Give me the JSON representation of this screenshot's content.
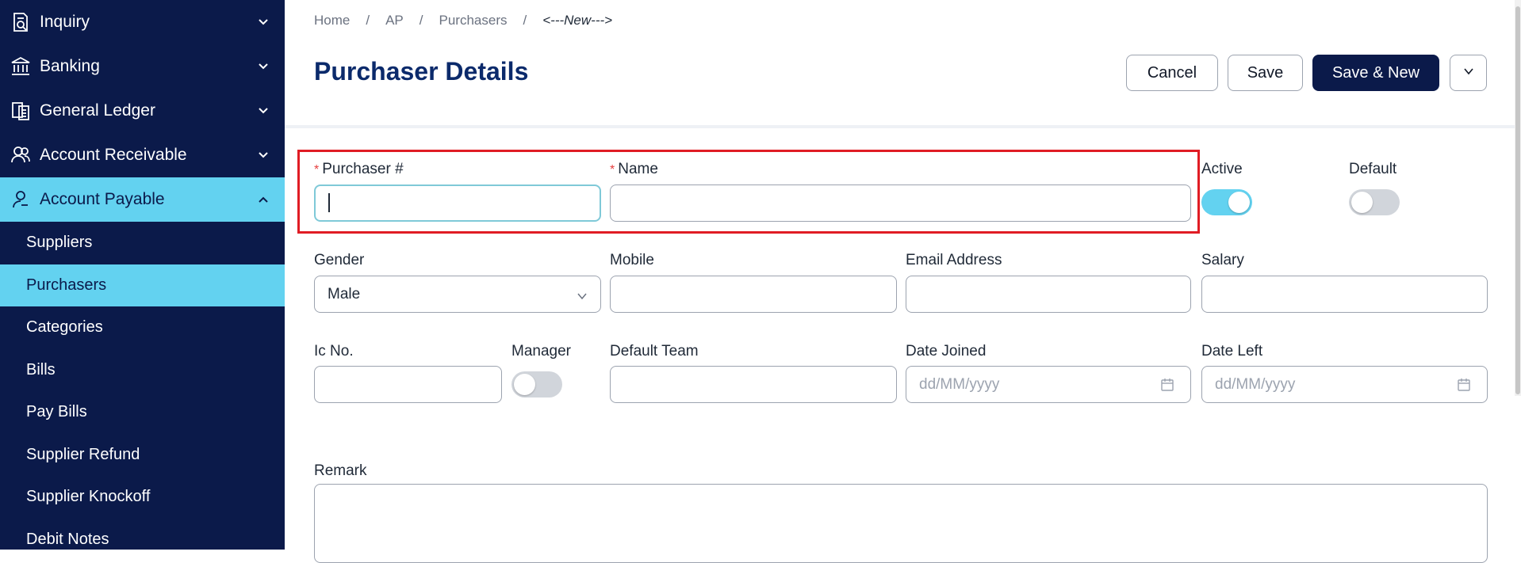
{
  "sidebar": {
    "groups": [
      {
        "label": "Inquiry",
        "icon": "inquiry-icon"
      },
      {
        "label": "Banking",
        "icon": "bank-icon"
      },
      {
        "label": "General Ledger",
        "icon": "ledger-icon"
      },
      {
        "label": "Account Receivable",
        "icon": "users-icon"
      },
      {
        "label": "Account Payable",
        "icon": "user-icon"
      }
    ],
    "sub_items": [
      {
        "label": "Suppliers"
      },
      {
        "label": "Purchasers"
      },
      {
        "label": "Categories"
      },
      {
        "label": "Bills"
      },
      {
        "label": "Pay Bills"
      },
      {
        "label": "Supplier Refund"
      },
      {
        "label": "Supplier Knockoff"
      },
      {
        "label": "Debit Notes"
      }
    ],
    "active_group": "Account Payable",
    "active_item": "Purchasers"
  },
  "breadcrumb": {
    "items": [
      "Home",
      "AP",
      "Purchasers"
    ],
    "separator": "/",
    "current": "<---New--->"
  },
  "page": {
    "title": "Purchaser Details"
  },
  "toolbar": {
    "cancel_label": "Cancel",
    "save_label": "Save",
    "save_new_label": "Save & New"
  },
  "form": {
    "purchaser_no": {
      "label": "Purchaser #",
      "required_mark": "*",
      "value": ""
    },
    "name": {
      "label": "Name",
      "required_mark": "*",
      "value": ""
    },
    "active": {
      "label": "Active",
      "on": true
    },
    "default": {
      "label": "Default",
      "on": false
    },
    "gender": {
      "label": "Gender",
      "value": "Male"
    },
    "mobile": {
      "label": "Mobile",
      "value": ""
    },
    "email": {
      "label": "Email Address",
      "value": ""
    },
    "salary": {
      "label": "Salary",
      "value": ""
    },
    "ic_no": {
      "label": "Ic No.",
      "value": ""
    },
    "manager": {
      "label": "Manager",
      "on": false
    },
    "default_team": {
      "label": "Default Team",
      "value": ""
    },
    "date_joined": {
      "label": "Date Joined",
      "placeholder": "dd/MM/yyyy"
    },
    "date_left": {
      "label": "Date Left",
      "placeholder": "dd/MM/yyyy"
    },
    "remark": {
      "label": "Remark",
      "value": ""
    }
  },
  "colors": {
    "sidebar_bg": "#0b1a4a",
    "accent": "#63d2f0",
    "title": "#0b2a6b",
    "required": "#e53e3e",
    "highlight": "#e01c24"
  }
}
